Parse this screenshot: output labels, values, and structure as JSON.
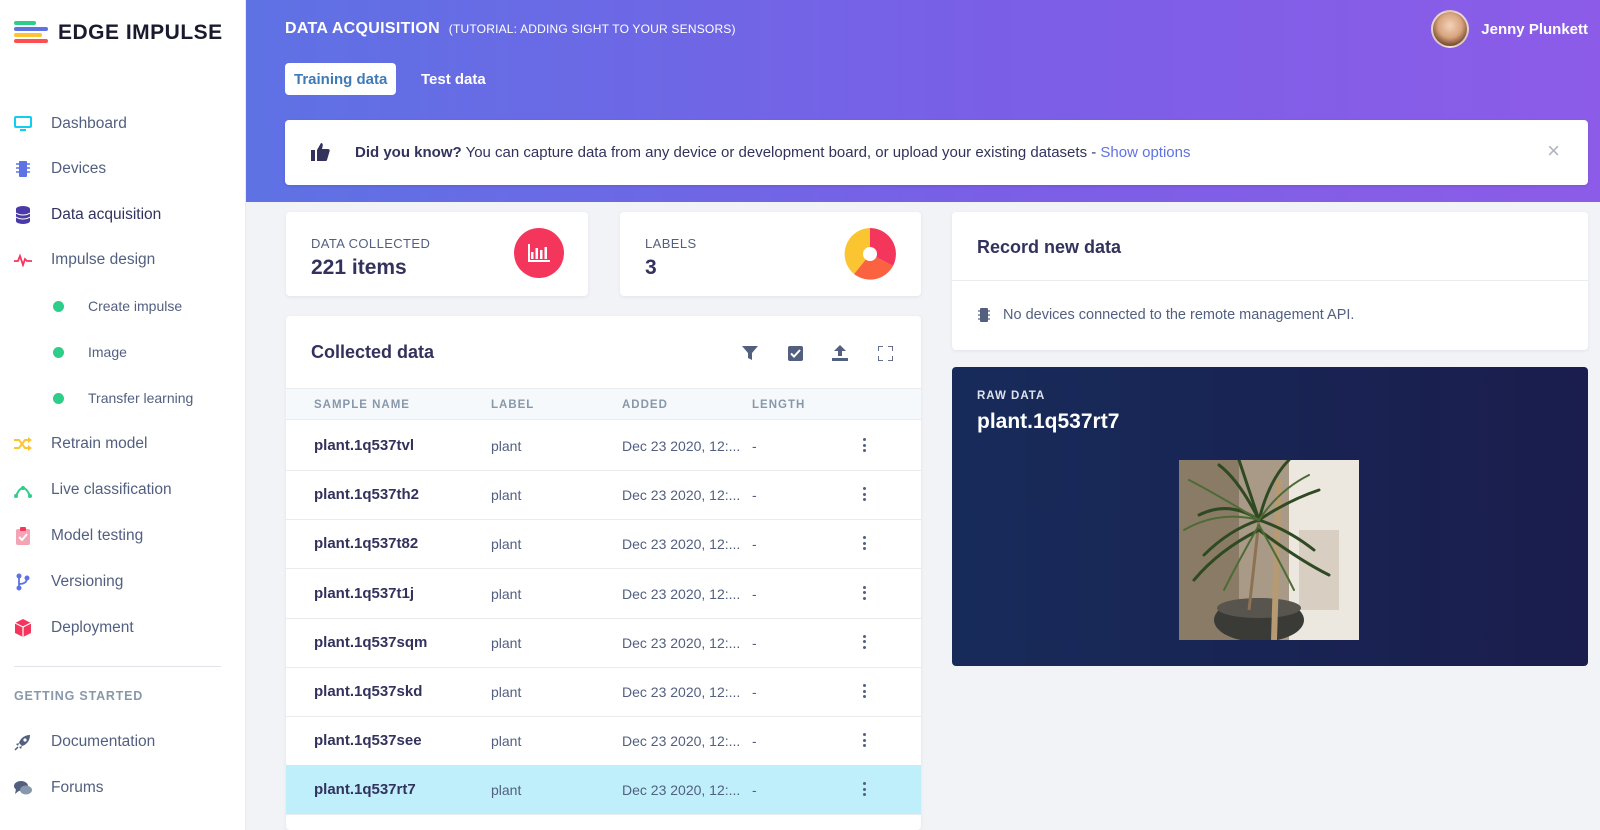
{
  "app": {
    "logo_text": "EDGE IMPULSE",
    "brand_colors": [
      "#2dce89",
      "#5e72e4",
      "#ff4e50",
      "#fbc531"
    ]
  },
  "sidebar": {
    "items": [
      {
        "label": "Dashboard",
        "icon": "monitor-icon"
      },
      {
        "label": "Devices",
        "icon": "chip-icon"
      },
      {
        "label": "Data acquisition",
        "icon": "database-icon",
        "active": true
      },
      {
        "label": "Impulse design",
        "icon": "pulse-icon"
      },
      {
        "label": "Create impulse",
        "sub": true
      },
      {
        "label": "Image",
        "sub": true
      },
      {
        "label": "Transfer learning",
        "sub": true
      },
      {
        "label": "Retrain model",
        "icon": "shuffle-icon"
      },
      {
        "label": "Live classification",
        "icon": "signal-icon"
      },
      {
        "label": "Model testing",
        "icon": "clipboard-check-icon"
      },
      {
        "label": "Versioning",
        "icon": "branch-icon"
      },
      {
        "label": "Deployment",
        "icon": "cube-icon"
      }
    ],
    "section_title": "GETTING STARTED",
    "getting_started": [
      {
        "label": "Documentation",
        "icon": "rocket-icon"
      },
      {
        "label": "Forums",
        "icon": "chat-icon"
      }
    ]
  },
  "header": {
    "title": "DATA ACQUISITION",
    "subtitle": "(TUTORIAL: ADDING SIGHT TO YOUR SENSORS)",
    "user_name": "Jenny Plunkett",
    "tabs": [
      {
        "label": "Training data",
        "active": true
      },
      {
        "label": "Test data",
        "active": false
      }
    ]
  },
  "tip": {
    "bold": "Did you know?",
    "text": " You can capture data from any device or development board, or upload your existing datasets - ",
    "link": "Show options",
    "close": "×"
  },
  "stats": {
    "collected_label": "DATA COLLECTED",
    "collected_value": "221 items",
    "labels_label": "LABELS",
    "labels_value": "3",
    "accent_color": "#f5365c"
  },
  "collected": {
    "title": "Collected data",
    "columns": [
      "SAMPLE NAME",
      "LABEL",
      "ADDED",
      "LENGTH"
    ],
    "rows": [
      {
        "name": "plant.1q537tvl",
        "label": "plant",
        "added": "Dec 23 2020, 12:...",
        "length": "-"
      },
      {
        "name": "plant.1q537th2",
        "label": "plant",
        "added": "Dec 23 2020, 12:...",
        "length": "-"
      },
      {
        "name": "plant.1q537t82",
        "label": "plant",
        "added": "Dec 23 2020, 12:...",
        "length": "-"
      },
      {
        "name": "plant.1q537t1j",
        "label": "plant",
        "added": "Dec 23 2020, 12:...",
        "length": "-"
      },
      {
        "name": "plant.1q537sqm",
        "label": "plant",
        "added": "Dec 23 2020, 12:...",
        "length": "-"
      },
      {
        "name": "plant.1q537skd",
        "label": "plant",
        "added": "Dec 23 2020, 12:...",
        "length": "-"
      },
      {
        "name": "plant.1q537see",
        "label": "plant",
        "added": "Dec 23 2020, 12:...",
        "length": "-"
      },
      {
        "name": "plant.1q537rt7",
        "label": "plant",
        "added": "Dec 23 2020, 12:...",
        "length": "-",
        "selected": true
      }
    ]
  },
  "record": {
    "title": "Record new data",
    "message": "No devices connected to the remote management API."
  },
  "raw": {
    "label": "RAW DATA",
    "name": "plant.1q537rt7"
  }
}
